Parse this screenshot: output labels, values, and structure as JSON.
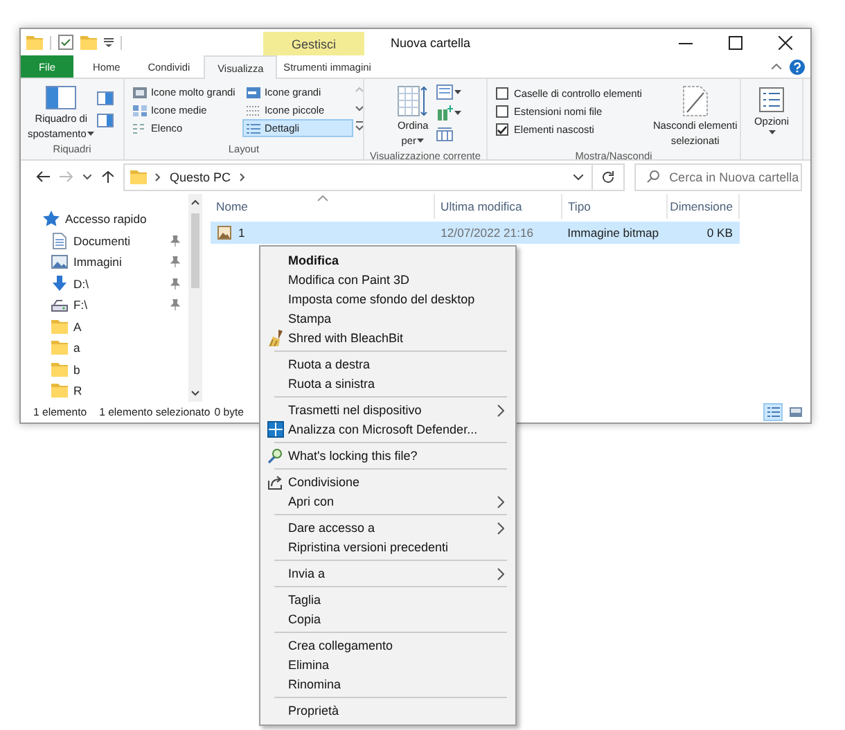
{
  "title_bar": {
    "title": "Nuova cartella",
    "context_tab": "Gestisci"
  },
  "ribbon_tabs": [
    {
      "label": "File",
      "selected": false,
      "kind": "file"
    },
    {
      "label": "Home",
      "selected": false,
      "kind": "tab"
    },
    {
      "label": "Condividi",
      "selected": false,
      "kind": "tab"
    },
    {
      "label": "Visualizza",
      "selected": true,
      "kind": "tab"
    },
    {
      "label": "Strumenti immagini",
      "selected": false,
      "kind": "context"
    }
  ],
  "ribbon": {
    "panes": {
      "label": "Riquadri",
      "button": "Riquadro di spostamento"
    },
    "layout": {
      "label": "Layout",
      "options": [
        {
          "label": "Icone molto grandi",
          "selected": false
        },
        {
          "label": "Icone grandi",
          "selected": false
        },
        {
          "label": "Icone medie",
          "selected": false
        },
        {
          "label": "Icone piccole",
          "selected": false
        },
        {
          "label": "Elenco",
          "selected": false
        },
        {
          "label": "Dettagli",
          "selected": true
        }
      ]
    },
    "current_view": {
      "label": "Visualizzazione corrente",
      "button": "Ordina per"
    },
    "show_hide": {
      "label": "Mostra/Nascondi",
      "checkboxes": [
        {
          "label": "Caselle di controllo elementi",
          "checked": false
        },
        {
          "label": "Estensioni nomi file",
          "checked": false
        },
        {
          "label": "Elementi nascosti",
          "checked": true
        }
      ],
      "button": "Nascondi elementi selezionati"
    },
    "options": {
      "button": "Opzioni"
    }
  },
  "address_bar": {
    "path": [
      "Questo PC"
    ],
    "search_placeholder": "Cerca in Nuova cartella"
  },
  "navigation_pane": {
    "items": [
      {
        "label": "Accesso rapido",
        "kind": "quick_access",
        "pinned": false,
        "children": [
          {
            "label": "Documenti",
            "kind": "documents",
            "pinned": true
          },
          {
            "label": "Immagini",
            "kind": "pictures",
            "pinned": true
          },
          {
            "label": "D:\\",
            "kind": "download",
            "pinned": true
          },
          {
            "label": "F:\\",
            "kind": "drive",
            "pinned": true
          },
          {
            "label": "A",
            "kind": "folder",
            "pinned": false
          },
          {
            "label": "a",
            "kind": "folder",
            "pinned": false
          },
          {
            "label": "b",
            "kind": "folder",
            "pinned": false
          },
          {
            "label": "R",
            "kind": "folder",
            "pinned": false
          }
        ]
      }
    ]
  },
  "file_list": {
    "columns": [
      "Nome",
      "Ultima modifica",
      "Tipo",
      "Dimensione"
    ],
    "rows": [
      {
        "cells": [
          "1",
          "12/07/2022 21:16",
          "Immagine bitmap",
          "0 KB"
        ],
        "selected": true
      }
    ]
  },
  "status_bar": {
    "items": [
      "1 elemento",
      "1 elemento selezionato",
      "0 byte"
    ],
    "views": [
      {
        "kind": "details",
        "selected": true
      },
      {
        "kind": "large_icons",
        "selected": false
      }
    ]
  },
  "context_menu": {
    "groups": [
      {
        "items": [
          {
            "label": "Modifica",
            "default": true,
            "submenu": false,
            "kind": "plain"
          },
          {
            "label": "Modifica con Paint 3D",
            "default": false,
            "submenu": false,
            "kind": "plain"
          },
          {
            "label": "Imposta come sfondo del desktop",
            "default": false,
            "submenu": false,
            "kind": "plain"
          },
          {
            "label": "Stampa",
            "default": false,
            "submenu": false,
            "kind": "plain"
          },
          {
            "label": "Shred with BleachBit",
            "default": false,
            "submenu": false,
            "kind": "shred"
          }
        ]
      },
      {
        "items": [
          {
            "label": "Ruota a destra",
            "default": false,
            "submenu": false,
            "kind": "plain"
          },
          {
            "label": "Ruota a sinistra",
            "default": false,
            "submenu": false,
            "kind": "plain"
          }
        ]
      },
      {
        "items": [
          {
            "label": "Trasmetti nel dispositivo",
            "default": false,
            "submenu": true,
            "kind": "plain"
          },
          {
            "label": "Analizza con Microsoft Defender...",
            "default": false,
            "submenu": false,
            "kind": "scan"
          }
        ]
      },
      {
        "items": [
          {
            "label": "What's locking this file?",
            "default": false,
            "submenu": false,
            "kind": "locking"
          }
        ]
      },
      {
        "items": [
          {
            "label": "Condivisione",
            "default": false,
            "submenu": false,
            "kind": "share"
          },
          {
            "label": "Apri con",
            "default": false,
            "submenu": true,
            "kind": "plain"
          }
        ]
      },
      {
        "items": [
          {
            "label": "Dare accesso a",
            "default": false,
            "submenu": true,
            "kind": "plain"
          },
          {
            "label": "Ripristina versioni precedenti",
            "default": false,
            "submenu": false,
            "kind": "plain"
          }
        ]
      },
      {
        "items": [
          {
            "label": "Invia a",
            "default": false,
            "submenu": true,
            "kind": "plain"
          }
        ]
      },
      {
        "items": [
          {
            "label": "Taglia",
            "default": false,
            "submenu": false,
            "kind": "plain"
          },
          {
            "label": "Copia",
            "default": false,
            "submenu": false,
            "kind": "plain"
          }
        ]
      },
      {
        "items": [
          {
            "label": "Crea collegamento",
            "default": false,
            "submenu": false,
            "kind": "plain"
          },
          {
            "label": "Elimina",
            "default": false,
            "submenu": false,
            "kind": "plain"
          },
          {
            "label": "Rinomina",
            "default": false,
            "submenu": false,
            "kind": "plain"
          }
        ]
      },
      {
        "items": [
          {
            "label": "Proprietà",
            "default": false,
            "submenu": false,
            "kind": "plain"
          }
        ]
      }
    ]
  }
}
